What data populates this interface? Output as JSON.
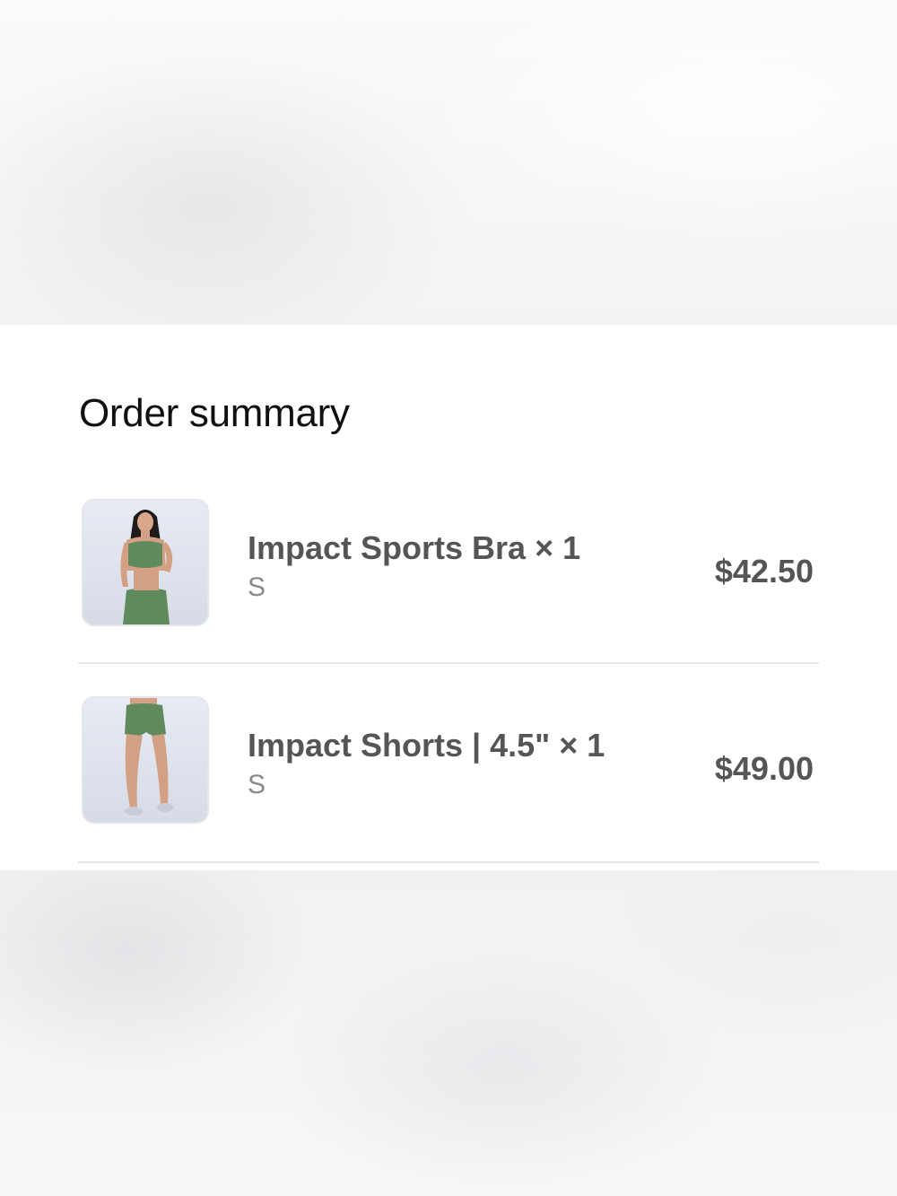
{
  "order_summary": {
    "title": "Order summary",
    "items": [
      {
        "name": "Impact Sports Bra × 1",
        "variant": "S",
        "price": "$42.50",
        "image_icon": "sports-bra-product-photo"
      },
      {
        "name": "Impact Shorts | 4.5\" × 1",
        "variant": "S",
        "price": "$49.00",
        "image_icon": "shorts-product-photo"
      }
    ]
  },
  "colors": {
    "product_green": "#5f8a5e",
    "text_dark": "#111111",
    "text_item": "#555555",
    "text_muted": "#8a8a8a",
    "divider": "#e4e4e4"
  }
}
